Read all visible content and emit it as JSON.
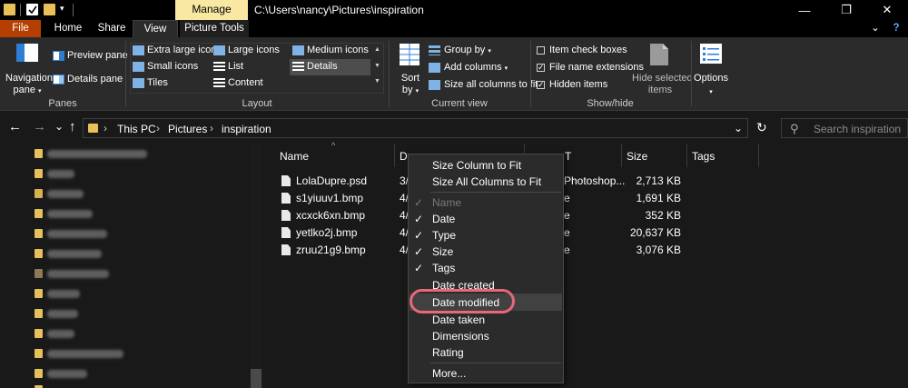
{
  "window": {
    "title_path": "C:\\Users\\nancy\\Pictures\\inspiration",
    "contextual_tab": "Manage",
    "minimize_glyph": "—",
    "maximize_glyph": "❐",
    "close_glyph": "✕"
  },
  "tabs": {
    "file": "File",
    "home": "Home",
    "share": "Share",
    "view": "View",
    "picture_tools": "Picture Tools",
    "collapse_glyph": "⌄",
    "help_glyph": "?"
  },
  "ribbon": {
    "panes": {
      "navigation_pane": "Navigation",
      "navigation_pane_2": "pane",
      "preview_pane": "Preview pane",
      "details_pane": "Details pane",
      "group_label": "Panes"
    },
    "layout": {
      "extra_large_icons": "Extra large icons",
      "large_icons": "Large icons",
      "medium_icons": "Medium icons",
      "small_icons": "Small icons",
      "list": "List",
      "details": "Details",
      "tiles": "Tiles",
      "content": "Content",
      "group_label": "Layout"
    },
    "current_view": {
      "sort_by": "Sort",
      "sort_by_2": "by",
      "group_by": "Group by",
      "add_columns": "Add columns",
      "size_all_columns": "Size all columns to fit",
      "group_label": "Current view"
    },
    "show_hide": {
      "item_check_boxes": "Item check boxes",
      "file_name_extensions": "File name extensions",
      "hidden_items": "Hidden items",
      "hide_selected_items": "Hide selected",
      "hide_selected_items_2": "items",
      "group_label": "Show/hide",
      "checkmark": "✓"
    },
    "options": {
      "label": "Options",
      "dropdown_glyph": "▾"
    }
  },
  "address_bar": {
    "back_glyph": "←",
    "forward_glyph": "→",
    "recent_glyph": "⌄",
    "up_glyph": "↑",
    "breadcrumb_sep": "›",
    "breadcrumb": [
      "This PC",
      "Pictures",
      "inspiration"
    ],
    "dropdown_glyph": "⌄",
    "refresh_glyph": "↻",
    "search_placeholder": "Search inspiration",
    "search_glyph": "⚲"
  },
  "columns": {
    "name": "Name",
    "date": "Da",
    "type": "T",
    "size": "Size",
    "tags": "Tags",
    "sort_glyph": "^"
  },
  "files": [
    {
      "name": "LolaDupre.psd",
      "date": "3/",
      "type": "Photoshop...",
      "size": "2,713 KB"
    },
    {
      "name": "s1yiuuv1.bmp",
      "date": "4/",
      "type": "e",
      "size": "1,691 KB"
    },
    {
      "name": "xcxck6xn.bmp",
      "date": "4/",
      "type": "e",
      "size": "352 KB"
    },
    {
      "name": "yetlko2j.bmp",
      "date": "4/",
      "type": "e",
      "size": "20,637 KB"
    },
    {
      "name": "zruu21g9.bmp",
      "date": "4/",
      "type": "e",
      "size": "3,076 KB"
    }
  ],
  "context_menu": {
    "size_column_to_fit": "Size Column to Fit",
    "size_all_columns_to_fit": "Size All Columns to Fit",
    "name": "Name",
    "date": "Date",
    "type": "Type",
    "size": "Size",
    "tags": "Tags",
    "date_created": "Date created",
    "date_modified": "Date modified",
    "date_taken": "Date taken",
    "dimensions": "Dimensions",
    "rating": "Rating",
    "more": "More...",
    "checkmark": "✓"
  },
  "colors": {
    "file_tab": "#b53f00",
    "manage_tab": "#f9e8a2",
    "highlight_ring": "#e8687a",
    "folder": "#e8c05a"
  }
}
